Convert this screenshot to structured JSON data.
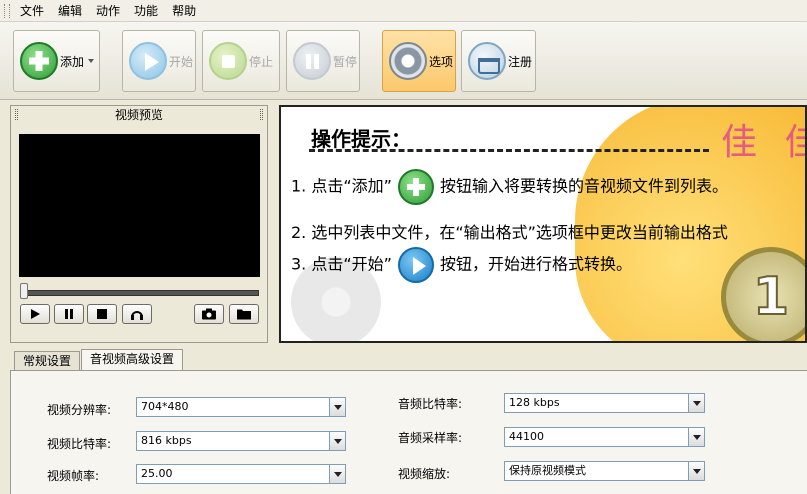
{
  "menu": [
    "文件",
    "编辑",
    "动作",
    "功能",
    "帮助"
  ],
  "toolbar": {
    "add": "添加",
    "start": "开始",
    "stop": "停止",
    "pause": "暂停",
    "options": "选项",
    "register": "注册"
  },
  "preview": {
    "title": "视频预览"
  },
  "tips": {
    "title": "操作提示：",
    "tip1_a": "1. 点击“添加”",
    "tip1_b": "按钮输入将要转换的音视频文件到列表。",
    "tip2": "2. 选中列表中文件，在“输出格式”选项框中更改当前输出格式",
    "tip3_a": "3. 点击“开始”",
    "tip3_b": "按钮，开始进行格式转换。",
    "badge": "1",
    "deco": "佳 佳"
  },
  "tabs": [
    "常规设置",
    "音视频高级设置"
  ],
  "settings": {
    "video_resolution_label": "视频分辨率:",
    "video_resolution_value": "704*480",
    "video_bitrate_label": "视频比特率:",
    "video_bitrate_value": "816 kbps",
    "video_fps_label": "视频帧率:",
    "video_fps_value": "25.00",
    "audio_bitrate_label": "音频比特率:",
    "audio_bitrate_value": "128 kbps",
    "audio_samplerate_label": "音频采样率:",
    "audio_samplerate_value": "44100",
    "video_scale_label": "视频缩放:",
    "video_scale_value": "保持原视频模式"
  }
}
